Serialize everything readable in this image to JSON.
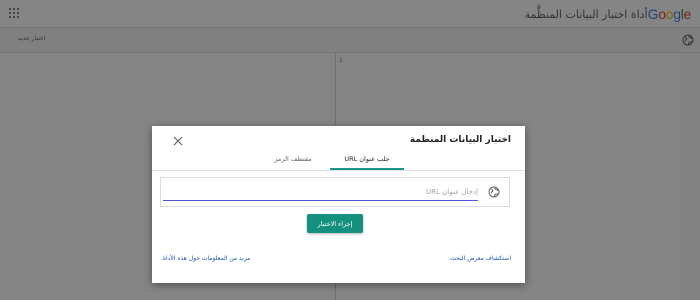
{
  "header": {
    "logo": {
      "letters": [
        "G",
        "o",
        "o",
        "g",
        "l",
        "e"
      ],
      "colors": [
        "#4285F4",
        "#EA4335",
        "#FBBC05",
        "#4285F4",
        "#34A853",
        "#EA4335"
      ]
    },
    "app_title": "أداة اختبار البيانات المنظَّمة",
    "apps_icon": "apps-grid-icon"
  },
  "background": {
    "new_test": "اختبار جديد",
    "line_number": "1",
    "globe_icon": "globe-icon"
  },
  "dialog": {
    "title": "اختبار البيانات المنظمة",
    "close_icon": "close-icon",
    "tabs": [
      {
        "label": "جلب عنوان URL",
        "active": true
      },
      {
        "label": "مقتطف الرمز",
        "active": false
      }
    ],
    "url_placeholder": "إدخال عنوان URL",
    "url_value": "",
    "url_icon": "globe-icon",
    "run_button": "إجراء الاختبار",
    "explore_link": "استكشاف معرض البحث.",
    "more_link": "مزيد من المعلومات حول هذه الأداة."
  },
  "colors": {
    "accent": "#14907f",
    "link": "#1a55b4",
    "input_underline": "#4a5bd1",
    "scrim": "rgba(0,0,0,0.48)"
  }
}
